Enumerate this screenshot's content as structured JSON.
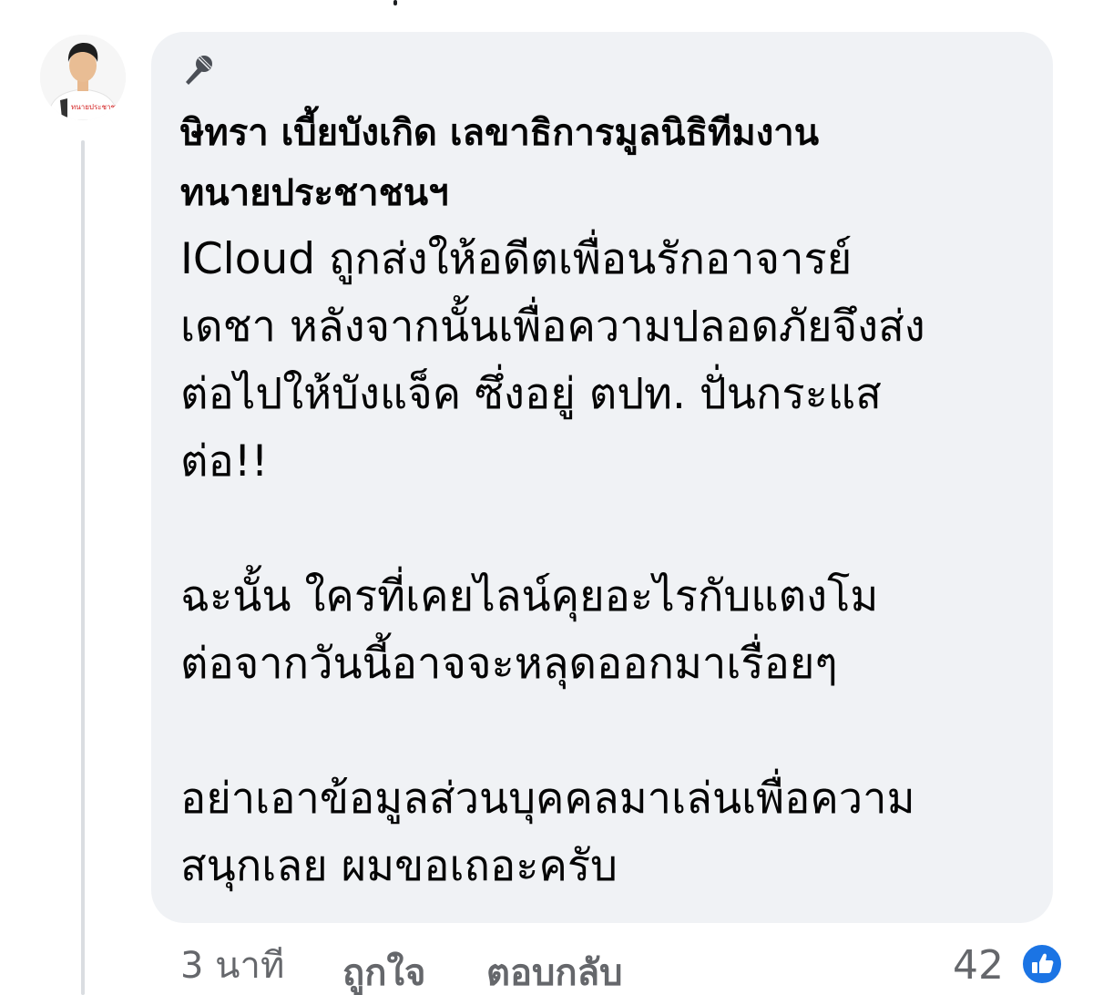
{
  "comment": {
    "author_lines": [
      "ษิทรา เบี้ยบังเกิด เลขาธิการมูลนิธิทีมงาน",
      "ทนายประชาชนฯ"
    ],
    "paragraphs": [
      {
        "lines": [
          "ICloud ถูกส่งให้อดีตเพื่อนรักอาจารย์",
          "เดชา หลังจากนั้นเพื่อความปลอดภัยจึงส่ง",
          "ต่อไปให้บังแจ็ค ซึ่งอยู่ ตปท. ปั่นกระแส",
          "ต่อ!!"
        ]
      },
      {
        "lines": [
          "ฉะนั้น ใครที่เคยไลน์คุยอะไรกับแตงโม",
          "ต่อจากวันนี้อาจจะหลุดออกมาเรื่อยๆ"
        ]
      },
      {
        "lines": [
          "อย่าเอาข้อมูลส่วนบุคคลมาเล่นเพื่อความ",
          "สนุกเลย ผมขอเถอะครับ"
        ]
      }
    ],
    "time": "3 นาที",
    "like_label": "ถูกใจ",
    "reply_label": "ตอบกลับ",
    "reaction_count": "42",
    "reaction_icon": "thumbs-up-icon",
    "badge_icon": "microphone-icon",
    "avatar_shirt_text": "ทนายประชาชน"
  },
  "colors": {
    "bubble": "#f0f2f5",
    "text": "#050505",
    "meta": "#65676b",
    "like_blue": "#1b74e4"
  }
}
